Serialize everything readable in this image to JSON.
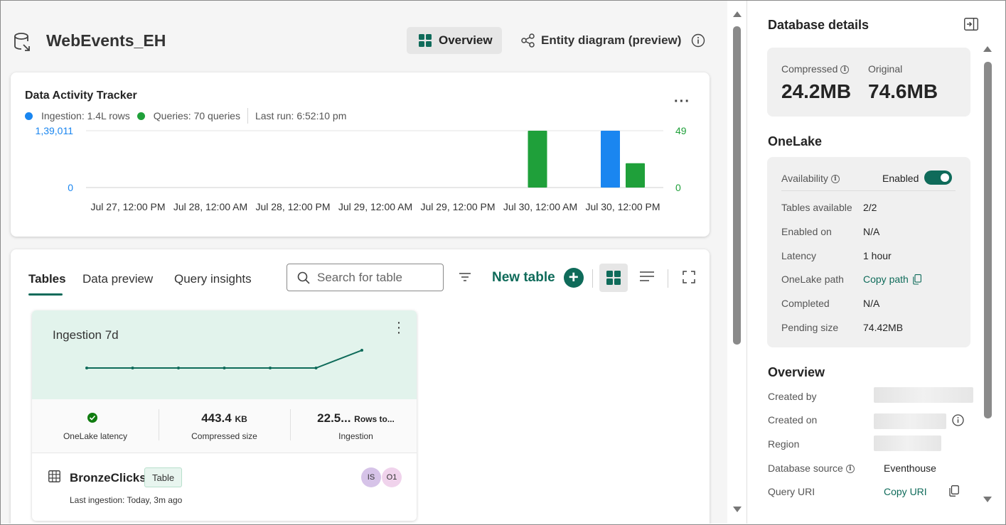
{
  "header": {
    "title": "WebEvents_EH",
    "overview_label": "Overview",
    "entity_label": "Entity diagram (preview)"
  },
  "tracker": {
    "title": "Data Activity Tracker",
    "ingestion_legend": "Ingestion: 1.4L rows",
    "queries_legend": "Queries: 70 queries",
    "last_run": "Last run: 6:52:10 pm",
    "more_label": "···"
  },
  "chart_data": {
    "type": "bar",
    "categories": [
      "Jul 27, 12:00 PM",
      "Jul 28, 12:00 AM",
      "Jul 28, 12:00 PM",
      "Jul 29, 12:00 AM",
      "Jul 29, 12:00 PM",
      "Jul 30, 12:00 AM",
      "Jul 30, 12:00 PM"
    ],
    "left_axis": {
      "labels": [
        "1,39,011",
        "0"
      ],
      "range": [
        0,
        139011
      ],
      "color": "#1a86f0"
    },
    "right_axis": {
      "labels": [
        "49",
        "0"
      ],
      "range": [
        0,
        49
      ],
      "color": "#1fa03a"
    },
    "series": [
      {
        "name": "Ingestion",
        "axis": "left",
        "color": "#1a86f0",
        "points": [
          {
            "x": "Jul 30, 12:00 PM",
            "value": 139011
          }
        ]
      },
      {
        "name": "Queries",
        "axis": "right",
        "color": "#1fa03a",
        "points": [
          {
            "x": "Jul 30, 12:00 AM",
            "value": 49
          },
          {
            "x": "Jul 30, 12:00 PM",
            "value": 21
          }
        ]
      }
    ],
    "grid": true
  },
  "tables_panel": {
    "tabs": [
      "Tables",
      "Data preview",
      "Query insights"
    ],
    "search_placeholder": "Search for table",
    "new_table_label": "New table"
  },
  "table_card": {
    "top_title": "Ingestion 7d",
    "sparkline": [
      0,
      0,
      0,
      0,
      0,
      0,
      1
    ],
    "stats": [
      {
        "value": "",
        "unit": "",
        "label": "OneLake latency"
      },
      {
        "value": "443.4",
        "unit": "KB",
        "label": "Compressed size"
      },
      {
        "value": "22.5...",
        "unit": "Rows to...",
        "label": "Ingestion"
      }
    ],
    "name": "BronzeClicks",
    "badge": "Table",
    "last_ingestion": "Last ingestion: Today, 3m ago",
    "avatars": [
      {
        "initials": "IS",
        "color": "#d6c3e8"
      },
      {
        "initials": "O1",
        "color": "#f0d3ec"
      }
    ]
  },
  "details": {
    "title": "Database details",
    "compressed_label": "Compressed",
    "compressed_value": "24.2MB",
    "original_label": "Original",
    "original_value": "74.6MB",
    "onelake_heading": "OneLake",
    "availability_label": "Availability",
    "availability_value": "Enabled",
    "rows": [
      {
        "label": "Tables available",
        "value": "2/2",
        "is_link": false
      },
      {
        "label": "Enabled on",
        "value": "N/A",
        "is_link": false
      },
      {
        "label": "Latency",
        "value": "1 hour",
        "is_link": false
      },
      {
        "label": "OneLake path",
        "value": "Copy path",
        "is_link": true
      },
      {
        "label": "Completed",
        "value": "N/A",
        "is_link": false
      },
      {
        "label": "Pending size",
        "value": "74.42MB",
        "is_link": false
      }
    ],
    "overview_heading": "Overview",
    "created_by_label": "Created by",
    "created_on_label": "Created on",
    "region_label": "Region",
    "db_source_label": "Database source",
    "db_source_value": "Eventhouse",
    "query_uri_label": "Query URI",
    "query_uri_value": "Copy URI"
  },
  "colors": {
    "accent": "#0f6b5a",
    "ingestion_blue": "#1a86f0",
    "queries_green": "#1fa03a"
  }
}
